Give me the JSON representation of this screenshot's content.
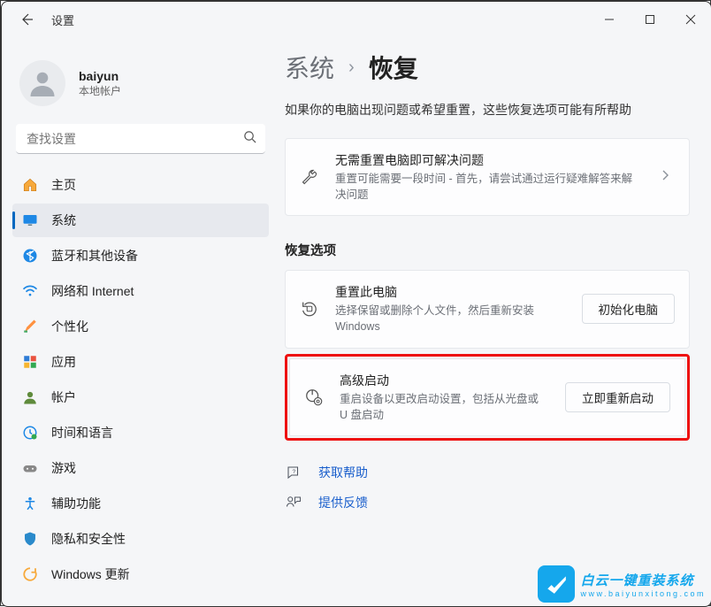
{
  "window": {
    "title": "设置"
  },
  "profile": {
    "name": "baiyun",
    "sub": "本地帐户"
  },
  "search": {
    "placeholder": "查找设置"
  },
  "nav": {
    "items": [
      {
        "label": "主页"
      },
      {
        "label": "系统"
      },
      {
        "label": "蓝牙和其他设备"
      },
      {
        "label": "网络和 Internet"
      },
      {
        "label": "个性化"
      },
      {
        "label": "应用"
      },
      {
        "label": "帐户"
      },
      {
        "label": "时间和语言"
      },
      {
        "label": "游戏"
      },
      {
        "label": "辅助功能"
      },
      {
        "label": "隐私和安全性"
      },
      {
        "label": "Windows 更新"
      }
    ]
  },
  "breadcrumb": {
    "parent": "系统",
    "current": "恢复"
  },
  "page_desc": "如果你的电脑出现问题或希望重置，这些恢复选项可能有所帮助",
  "cards": {
    "troubleshoot": {
      "title": "无需重置电脑即可解决问题",
      "sub": "重置可能需要一段时间 - 首先，请尝试通过运行疑难解答来解决问题"
    },
    "reset": {
      "title": "重置此电脑",
      "sub": "选择保留或删除个人文件，然后重新安装 Windows",
      "button": "初始化电脑"
    },
    "advanced": {
      "title": "高级启动",
      "sub": "重启设备以更改启动设置，包括从光盘或 U 盘启动",
      "button": "立即重新启动"
    }
  },
  "section_recovery": "恢复选项",
  "links": {
    "help": "获取帮助",
    "feedback": "提供反馈"
  },
  "watermark": {
    "t1": "白云一键重装系统",
    "t2": "www.baiyunxitong.com"
  }
}
